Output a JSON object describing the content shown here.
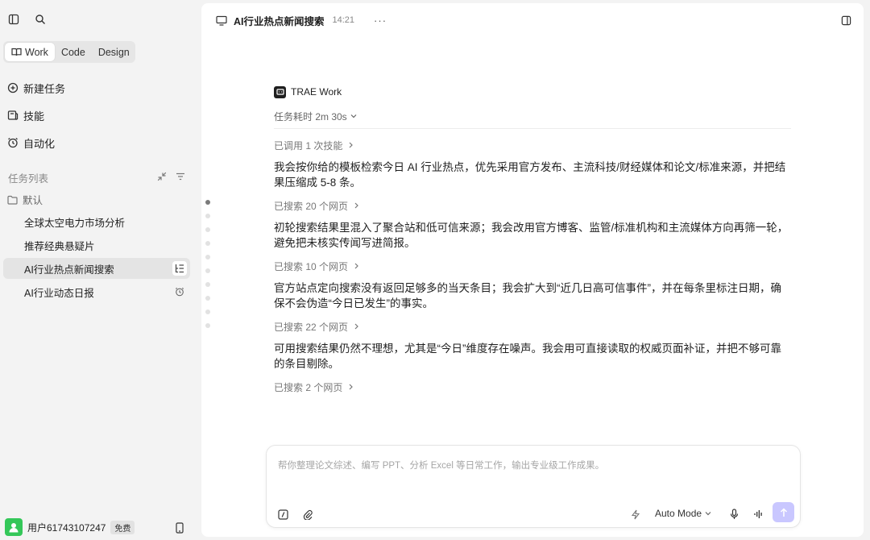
{
  "sidebar": {
    "segments": [
      "Work",
      "Code",
      "Design"
    ],
    "nav": [
      {
        "label": "新建任务",
        "icon": "plus-circle-icon"
      },
      {
        "label": "技能",
        "icon": "book-icon"
      },
      {
        "label": "自动化",
        "icon": "alarm-clock-icon"
      }
    ],
    "task_list_title": "任务列表",
    "folder_label": "默认",
    "tasks": [
      {
        "label": "全球太空电力市场分析"
      },
      {
        "label": "推荐经典悬疑片"
      },
      {
        "label": "AI行业热点新闻搜索",
        "active": true
      },
      {
        "label": "AI行业动态日报"
      }
    ],
    "user": {
      "name": "用户61743107247",
      "plan_badge": "免费"
    }
  },
  "header": {
    "title": "AI行业热点新闻搜索",
    "time": "14:21",
    "more": "···"
  },
  "conversation": {
    "agent_name": "TRAE Work",
    "duration": "任务耗时 2m 30s",
    "steps": [
      {
        "type": "step",
        "text": "已调用 1 次技能"
      },
      {
        "type": "para",
        "text": "我会按你给的模板检索今日 AI 行业热点，优先采用官方发布、主流科技/财经媒体和论文/标准来源，并把结果压缩成 5-8 条。"
      },
      {
        "type": "step",
        "text": "已搜索 20 个网页"
      },
      {
        "type": "para",
        "text": "初轮搜索结果里混入了聚合站和低可信来源；我会改用官方博客、监管/标准机构和主流媒体方向再筛一轮，避免把未核实传闻写进简报。"
      },
      {
        "type": "step",
        "text": "已搜索 10 个网页"
      },
      {
        "type": "para",
        "text": "官方站点定向搜索没有返回足够多的当天条目；我会扩大到“近几日高可信事件”，并在每条里标注日期，确保不会伪造“今日已发生”的事实。"
      },
      {
        "type": "step",
        "text": "已搜索 22 个网页"
      },
      {
        "type": "para",
        "text": "可用搜索结果仍然不理想，尤其是“今日”维度存在噪声。我会用可直接读取的权威页面补证，并把不够可靠的条目剔除。"
      },
      {
        "type": "step",
        "text": "已搜索 2 个网页"
      }
    ]
  },
  "composer": {
    "placeholder": "帮你整理论文综述、编写 PPT、分析 Excel 等日常工作，输出专业级工作成果。",
    "mode": "Auto Mode"
  },
  "colors": {
    "send_button": "#c9c7ff",
    "avatar": "#34c759",
    "active_task_bg": "#e4e4e4"
  }
}
